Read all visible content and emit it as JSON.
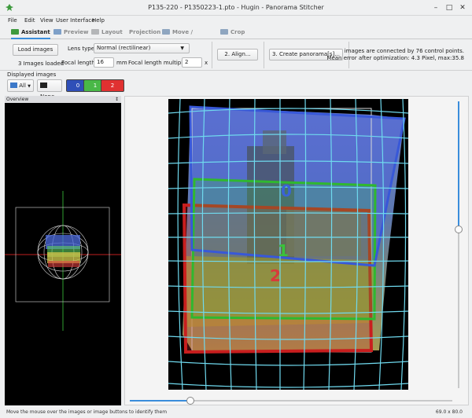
{
  "window": {
    "title": "P135-220 - P1350223-1.pto - Hugin - Panorama Stitcher",
    "controls": {
      "minimize": "–",
      "maximize": "□",
      "close": "✕"
    }
  },
  "menu": [
    "File",
    "Edit",
    "View",
    "User Interface",
    "Help"
  ],
  "tabs": [
    {
      "label": "Assistant",
      "active": true
    },
    {
      "label": "Preview",
      "active": false
    },
    {
      "label": "Layout",
      "active": false
    },
    {
      "label": "Projection",
      "active": false
    },
    {
      "label": "Move / Drag",
      "active": false
    },
    {
      "label": "Crop",
      "active": false
    }
  ],
  "assistant": {
    "load_images": "Load images",
    "images_loaded": "3 Images loaded",
    "lens_type_label": "Lens type:",
    "lens_type_value": "Normal (rectilinear)",
    "focal_length_label": "Focal length:",
    "focal_length_value": "16",
    "focal_length_unit": "mm",
    "multiplier_label": "Focal length multiplier:",
    "multiplier_value": "2",
    "multiplier_unit": "x",
    "align_button": "2. Align...",
    "create_button": "3. Create panorama[s]...",
    "status_line1": "images are connected by 76 control points.",
    "status_line2": "Mean error after optimization: 4.3 Pixel, max:35.8"
  },
  "displayed_images": {
    "label": "Displayed images",
    "all": "All",
    "none": "None",
    "images": [
      {
        "label": "0",
        "color": "#2f4fb8"
      },
      {
        "label": "1",
        "color": "#49b847"
      },
      {
        "label": "2",
        "color": "#e03131"
      }
    ]
  },
  "overview": {
    "title": "Overview",
    "pin": "↕"
  },
  "preview": {
    "image_labels": [
      {
        "label": "0",
        "color": "#3a63d8"
      },
      {
        "label": "1",
        "color": "#3ac23a"
      },
      {
        "label": "2",
        "color": "#d83a3a"
      }
    ]
  },
  "zoom": {
    "horizontal": 0.21,
    "vertical": 0.42
  },
  "status": {
    "hint": "Move the mouse over the images or image buttons to identify them",
    "fov": "69.0 x 80.0"
  }
}
